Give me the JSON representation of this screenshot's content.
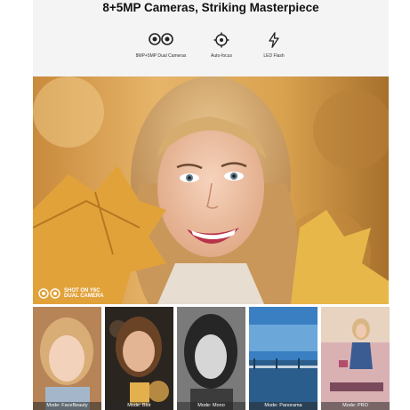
{
  "title": "8+5MP Cameras, Striking Masterpiece",
  "features": [
    {
      "icon": "dual-camera-icon",
      "label": "8MP+5MP Dual Cameras"
    },
    {
      "icon": "autofocus-icon",
      "label": "Auto-focus"
    },
    {
      "icon": "flash-icon",
      "label": "LED Flash"
    }
  ],
  "hero": {
    "badge_line1": "SHOT ON Y6C",
    "badge_line2": "DUAL CAMERA"
  },
  "modes": [
    {
      "label": "Mode: FaceBeauty"
    },
    {
      "label": "Mode: Blur"
    },
    {
      "label": "Mode: Mono"
    },
    {
      "label": "Mode: Panorama"
    },
    {
      "label": "Mode: PRO"
    }
  ]
}
